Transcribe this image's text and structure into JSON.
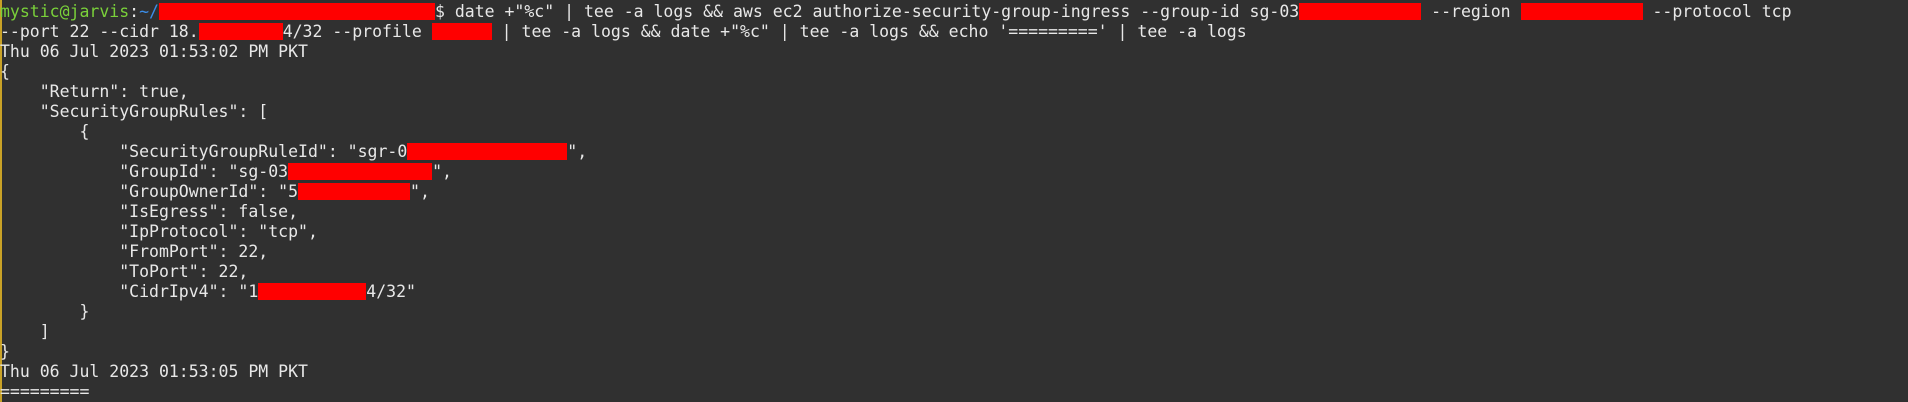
{
  "prompt": {
    "user_host": "mystic@jarvis",
    "sep": ":",
    "path": "~/",
    "dollar": "$"
  },
  "command": {
    "part1": " date +\"%c\" | tee -a logs && aws ec2 authorize-security-group-ingress --group-id sg-03",
    "part2": " --region ",
    "part3": " --protocol tcp",
    "line2_a": "--port 22 --cidr 18.",
    "line2_b": "4/32 --profile ",
    "line2_c": " | tee -a logs && date +\"%c\" | tee -a logs && echo '=========' | tee -a logs"
  },
  "date_start": "Thu 06 Jul 2023 01:53:02 PM PKT",
  "json_output": {
    "open_brace": "{",
    "return_line": "    \"Return\": true,",
    "rules_line": "    \"SecurityGroupRules\": [",
    "inner_open": "        {",
    "rule_id_a": "            \"SecurityGroupRuleId\": \"sgr-0",
    "rule_id_b": "\",",
    "group_id_a": "            \"GroupId\": \"sg-03",
    "group_id_b": "\",",
    "owner_a": "            \"GroupOwnerId\": \"5",
    "owner_b": "\",",
    "is_egress": "            \"IsEgress\": false,",
    "ip_protocol": "            \"IpProtocol\": \"tcp\",",
    "from_port": "            \"FromPort\": 22,",
    "to_port": "            \"ToPort\": 22,",
    "cidr_a": "            \"CidrIpv4\": \"1",
    "cidr_b": "4/32\"",
    "inner_close": "        }",
    "array_close": "    ]",
    "close_brace": "}"
  },
  "date_end": "Thu 06 Jul 2023 01:53:05 PM PKT",
  "separator": "========="
}
